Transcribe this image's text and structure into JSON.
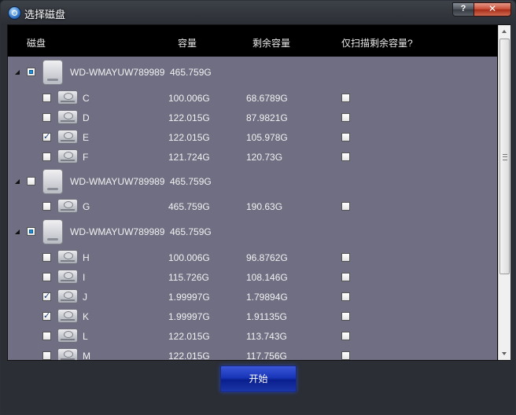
{
  "window": {
    "title": "选择磁盘",
    "help_label": "?",
    "close_label": "✕"
  },
  "header": {
    "col_disk": "磁盘",
    "col_capacity": "容量",
    "col_remaining": "剩余容量",
    "col_scan_remaining": "仅扫描剩余容量?"
  },
  "disks": [
    {
      "name": "WD-WMAYUW789989",
      "capacity": "465.759G",
      "state": "partial"
    },
    {
      "name": "WD-WMAYUW789989",
      "capacity": "465.759G",
      "state": "unchecked"
    },
    {
      "name": "WD-WMAYUW789989",
      "capacity": "465.759G",
      "state": "partial"
    }
  ],
  "partitions": [
    {
      "letter": "C",
      "capacity": "100.006G",
      "remaining": "68.6789G",
      "checked": false
    },
    {
      "letter": "D",
      "capacity": "122.015G",
      "remaining": "87.9821G",
      "checked": false
    },
    {
      "letter": "E",
      "capacity": "122.015G",
      "remaining": "105.978G",
      "checked": true
    },
    {
      "letter": "F",
      "capacity": "121.724G",
      "remaining": "120.73G",
      "checked": false
    },
    {
      "letter": "G",
      "capacity": "465.759G",
      "remaining": "190.63G",
      "checked": false
    },
    {
      "letter": "H",
      "capacity": "100.006G",
      "remaining": "96.8762G",
      "checked": false
    },
    {
      "letter": "I",
      "capacity": "115.726G",
      "remaining": "108.146G",
      "checked": false
    },
    {
      "letter": "J",
      "capacity": "1.99997G",
      "remaining": "1.79894G",
      "checked": true
    },
    {
      "letter": "K",
      "capacity": "1.99997G",
      "remaining": "1.91135G",
      "checked": true
    },
    {
      "letter": "L",
      "capacity": "122.015G",
      "remaining": "113.743G",
      "checked": false
    },
    {
      "letter": "M",
      "capacity": "122.015G",
      "remaining": "117.756G",
      "checked": false
    }
  ],
  "footer": {
    "start_label": "开始"
  }
}
